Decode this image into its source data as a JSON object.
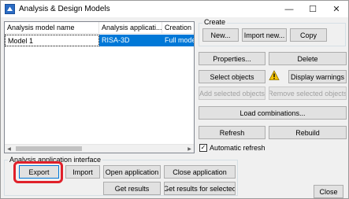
{
  "window": {
    "title": "Analysis & Design Models",
    "minimize_glyph": "—",
    "maximize_glyph": "☐",
    "close_glyph": "✕"
  },
  "grid": {
    "columns": [
      "Analysis model name",
      "Analysis applicati...",
      "Creation m"
    ],
    "rows": [
      {
        "name": "Model 1",
        "application": "RISA-3D",
        "creation": "Full mode"
      }
    ],
    "selected_color": "#0078d7"
  },
  "create": {
    "title": "Create",
    "new_label": "New...",
    "import_new_label": "Import new...",
    "copy_label": "Copy"
  },
  "actions": {
    "properties_label": "Properties...",
    "delete_label": "Delete",
    "select_objects_label": "Select objects",
    "warning_icon": "warning-icon",
    "display_warnings_label": "Display warnings",
    "add_selected_label": "Add selected objects",
    "remove_selected_label": "Remove selected objects",
    "load_combinations_label": "Load combinations...",
    "refresh_label": "Refresh",
    "rebuild_label": "Rebuild",
    "automatic_refresh_label": "Automatic refresh",
    "automatic_refresh_checked": true,
    "check_glyph": "✓"
  },
  "interface": {
    "title": "Analysis application interface",
    "export_label": "Export",
    "import_label": "Import",
    "open_application_label": "Open application",
    "close_application_label": "Close application",
    "get_results_label": "Get results",
    "get_results_selected_label": "Get results for selected"
  },
  "footer": {
    "close_label": "Close"
  },
  "colors": {
    "highlight": "#e0202a",
    "warning": "#f5c400"
  }
}
